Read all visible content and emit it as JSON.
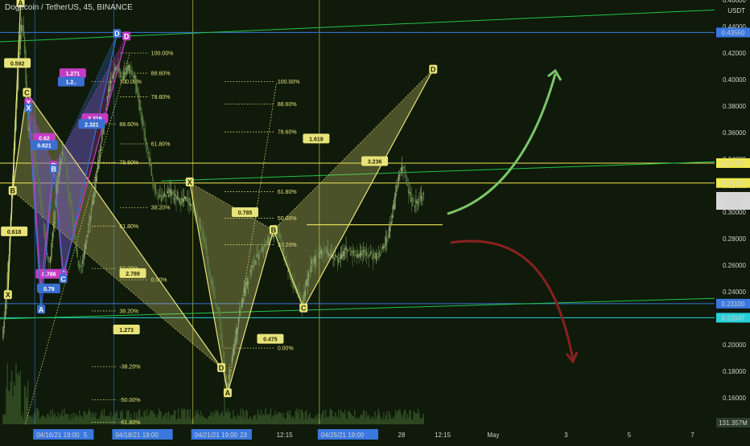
{
  "symbol_title": "Dogecoin / TetherUS, 45, BINANCE",
  "currency_label": "USDT",
  "colors": {
    "background": "#0f1a0a",
    "candle_up": "#8aa36b",
    "candle_down": "#5c7a40",
    "volume": "#2f4a22",
    "pattern_yellow": "#e8e37a",
    "pattern_magenta": "#c43cc4",
    "pattern_blue": "#3a6ed0",
    "line_green": "#22c34a",
    "line_blue": "#3a78e0",
    "line_cyan": "#26d0d8",
    "line_yellow": "#f0e850",
    "arrow_green": "#7cc46a",
    "arrow_red": "#8a2020",
    "current_price_bg": "#d8d8d8"
  },
  "chart_data": {
    "type": "candlestick",
    "title": "Dogecoin / TetherUS, 45, BINANCE",
    "ylabel": "USDT",
    "scale": "linear",
    "ylim": [
      0.14,
      0.46
    ],
    "price_ticks": [
      "0.46000",
      "0.44000",
      "0.42000",
      "0.40000",
      "0.38000",
      "0.36000",
      "0.34000",
      "0.32000",
      "0.30000",
      "0.28000",
      "0.26000",
      "0.24000",
      "0.22000",
      "0.20000",
      "0.18000",
      "0.16000"
    ],
    "time_ticks": [
      {
        "label": "04/16/21   19:00",
        "t": 0.0,
        "highlight": true
      },
      {
        "label": "5",
        "t": 1.6,
        "highlight": false
      },
      {
        "label": "04/18/21   19:00",
        "t": 2.5,
        "highlight": true
      },
      {
        "label": "04/21/21   19:00",
        "t": 5.0,
        "highlight": true
      },
      {
        "label": "23",
        "t": 6.6,
        "highlight": false
      },
      {
        "label": "12:15",
        "t": 7.9,
        "highlight": false
      },
      {
        "label": "04/25/21   19:00",
        "t": 9.0,
        "highlight": true
      },
      {
        "label": "28",
        "t": 11.6,
        "highlight": false
      },
      {
        "label": "12:15",
        "t": 12.9,
        "highlight": false
      },
      {
        "label": "May",
        "t": 14.5,
        "highlight": false
      },
      {
        "label": "3",
        "t": 16.8,
        "highlight": false
      },
      {
        "label": "5",
        "t": 18.8,
        "highlight": false
      },
      {
        "label": "7",
        "t": 20.8,
        "highlight": false
      }
    ],
    "tlim": [
      -1.1,
      21.5
    ],
    "price_path": [
      [
        -1.0,
        0.205
      ],
      [
        -0.9,
        0.228
      ],
      [
        -0.8,
        0.262
      ],
      [
        -0.7,
        0.31
      ],
      [
        -0.55,
        0.385
      ],
      [
        -0.4,
        0.445
      ],
      [
        -0.3,
        0.432
      ],
      [
        -0.2,
        0.365
      ],
      [
        -0.1,
        0.36
      ],
      [
        0.0,
        0.34
      ],
      [
        0.1,
        0.33
      ],
      [
        0.25,
        0.302
      ],
      [
        0.4,
        0.27
      ],
      [
        0.5,
        0.262
      ],
      [
        0.6,
        0.285
      ],
      [
        0.75,
        0.325
      ],
      [
        0.9,
        0.345
      ],
      [
        1.0,
        0.338
      ],
      [
        1.1,
        0.315
      ],
      [
        1.25,
        0.29
      ],
      [
        1.4,
        0.262
      ],
      [
        1.5,
        0.258
      ],
      [
        1.6,
        0.272
      ],
      [
        1.8,
        0.3
      ],
      [
        2.0,
        0.33
      ],
      [
        2.2,
        0.365
      ],
      [
        2.4,
        0.395
      ],
      [
        2.6,
        0.412
      ],
      [
        2.8,
        0.398
      ],
      [
        2.9,
        0.405
      ],
      [
        3.0,
        0.41
      ],
      [
        3.2,
        0.4
      ],
      [
        3.4,
        0.372
      ],
      [
        3.6,
        0.345
      ],
      [
        3.8,
        0.32
      ],
      [
        4.0,
        0.31
      ],
      [
        4.3,
        0.315
      ],
      [
        4.6,
        0.308
      ],
      [
        4.8,
        0.31
      ],
      [
        5.0,
        0.305
      ],
      [
        5.2,
        0.292
      ],
      [
        5.4,
        0.278
      ],
      [
        5.5,
        0.262
      ],
      [
        5.6,
        0.248
      ],
      [
        5.75,
        0.232
      ],
      [
        5.85,
        0.225
      ],
      [
        5.95,
        0.2
      ],
      [
        6.0,
        0.19
      ],
      [
        6.05,
        0.175
      ],
      [
        6.1,
        0.168
      ],
      [
        6.2,
        0.18
      ],
      [
        6.35,
        0.2
      ],
      [
        6.5,
        0.225
      ],
      [
        6.7,
        0.245
      ],
      [
        6.9,
        0.258
      ],
      [
        7.1,
        0.268
      ],
      [
        7.3,
        0.275
      ],
      [
        7.5,
        0.282
      ],
      [
        7.7,
        0.285
      ],
      [
        7.85,
        0.276
      ],
      [
        8.0,
        0.26
      ],
      [
        8.2,
        0.246
      ],
      [
        8.4,
        0.235
      ],
      [
        8.5,
        0.23
      ],
      [
        8.6,
        0.245
      ],
      [
        8.8,
        0.262
      ],
      [
        9.0,
        0.268
      ],
      [
        9.3,
        0.27
      ],
      [
        9.6,
        0.264
      ],
      [
        9.9,
        0.272
      ],
      [
        10.2,
        0.268
      ],
      [
        10.5,
        0.27
      ],
      [
        10.8,
        0.266
      ],
      [
        11.0,
        0.27
      ],
      [
        11.2,
        0.282
      ],
      [
        11.35,
        0.3
      ],
      [
        11.45,
        0.315
      ],
      [
        11.55,
        0.328
      ],
      [
        11.65,
        0.335
      ],
      [
        11.75,
        0.328
      ],
      [
        11.9,
        0.312
      ],
      [
        12.0,
        0.305
      ],
      [
        12.15,
        0.31
      ],
      [
        12.3,
        0.312
      ]
    ],
    "current_price": 0.31154,
    "countdown": "20:30",
    "volume_label": "131.357M",
    "horizontal_levels": [
      {
        "value": 0.4355,
        "label": "0.43550",
        "color": "#3a78e0"
      },
      {
        "value": 0.337,
        "label": "0.33700",
        "color": "#f0e850"
      },
      {
        "value": 0.322,
        "label": "0.32200",
        "color": "#f0e850"
      },
      {
        "value": 0.231,
        "label": "0.23100",
        "color": "#3a78e0"
      },
      {
        "value": 0.22037,
        "label": "0.22037",
        "color": "#26d0d8"
      }
    ],
    "trendlines": [
      {
        "t1": -1.1,
        "p1": 0.4285,
        "t2": 21.5,
        "p2": 0.4525,
        "color": "#22c34a"
      },
      {
        "t1": 4.0,
        "p1": 0.3235,
        "t2": 21.5,
        "p2": 0.338,
        "color": "#22c34a"
      },
      {
        "t1": -1.1,
        "p1": 0.2195,
        "t2": 21.5,
        "p2": 0.235,
        "color": "#22c34a"
      }
    ],
    "vertical_markers": [
      {
        "t": 0.0,
        "color": "#3a78e0"
      },
      {
        "t": 2.5,
        "color": "#3a78e0"
      },
      {
        "t": 5.0,
        "color": "#f0e850"
      },
      {
        "t": 9.0,
        "color": "#f0e850"
      }
    ],
    "yellow_segment": {
      "t1": 8.6,
      "t2": 12.9,
      "value": 0.2905
    },
    "patterns": [
      {
        "name": "yellow-main",
        "color": "#e8e37a",
        "points": [
          {
            "label": "X",
            "t": 4.9,
            "p": 0.3225
          },
          {
            "label": "A",
            "t": 6.1,
            "p": 0.1635
          },
          {
            "label": "B",
            "t": 7.55,
            "p": 0.2865
          },
          {
            "label": "C",
            "t": 8.5,
            "p": 0.2275
          },
          {
            "label": "D",
            "t": 12.6,
            "p": 0.4075
          }
        ],
        "ratios": [
          {
            "text": "0.785",
            "t": 6.65,
            "p": 0.3
          },
          {
            "text": "0.475",
            "t": 7.45,
            "p": 0.2045
          },
          {
            "text": "1.619",
            "t": 8.9,
            "p": 0.3555
          },
          {
            "text": "3.236",
            "t": 10.75,
            "p": 0.3385
          }
        ]
      },
      {
        "name": "yellow-left",
        "color": "#e8e37a",
        "points": [
          {
            "label": "X",
            "t": -0.85,
            "p": 0.2375
          },
          {
            "label": "A",
            "t": -0.45,
            "p": 0.4575
          },
          {
            "label": "B",
            "t": -0.7,
            "p": 0.316
          },
          {
            "label": "C",
            "t": -0.25,
            "p": 0.39
          },
          {
            "label": "D",
            "t": 5.9,
            "p": 0.1825
          }
        ],
        "ratios": [
          {
            "text": "0.592",
            "t": -0.55,
            "p": 0.4125
          },
          {
            "text": "0.618",
            "t": -0.65,
            "p": 0.2855
          },
          {
            "text": "2.789",
            "t": 3.1,
            "p": 0.254
          },
          {
            "text": "1.273",
            "t": 2.9,
            "p": 0.2115
          }
        ]
      },
      {
        "name": "magenta",
        "color": "#c43cc4",
        "points": [
          {
            "label": "X",
            "t": -0.2,
            "p": 0.3825
          },
          {
            "label": "A",
            "t": 0.2,
            "p": 0.2425
          },
          {
            "label": "B",
            "t": 0.6,
            "p": 0.335
          },
          {
            "label": "C",
            "t": 0.9,
            "p": 0.2535
          },
          {
            "label": "D",
            "t": 2.9,
            "p": 0.4325
          }
        ],
        "ratios": [
          {
            "text": "0.62",
            "t": 0.3,
            "p": 0.356
          },
          {
            "text": "0.786",
            "t": 0.45,
            "p": 0.2535
          },
          {
            "text": "1.271",
            "t": 1.2,
            "p": 0.4048
          },
          {
            "text": "2.336",
            "t": 1.9,
            "p": 0.3708
          }
        ]
      },
      {
        "name": "blue",
        "color": "#3a6ed0",
        "points": [
          {
            "label": "X",
            "t": -0.2,
            "p": 0.3785
          },
          {
            "label": "A",
            "t": 0.2,
            "p": 0.2265
          },
          {
            "label": "B",
            "t": 0.6,
            "p": 0.3325
          },
          {
            "label": "C",
            "t": 0.9,
            "p": 0.2495
          },
          {
            "label": "D",
            "t": 2.6,
            "p": 0.4345
          }
        ],
        "ratios": [
          {
            "text": "0.621",
            "t": 0.3,
            "p": 0.3505
          },
          {
            "text": "0.79",
            "t": 0.45,
            "p": 0.2425
          },
          {
            "text": "1.2..",
            "t": 1.15,
            "p": 0.3985
          },
          {
            "text": "2.321",
            "t": 1.8,
            "p": 0.3665
          }
        ]
      }
    ],
    "fib_groups": [
      {
        "t1": 2.7,
        "t2": 3.6,
        "levels": [
          {
            "text": "100.00%",
            "p": 0.42
          },
          {
            "text": "88.60%",
            "p": 0.4048
          },
          {
            "text": "78.60%",
            "p": 0.387
          },
          {
            "text": "61.80%",
            "p": 0.3515
          },
          {
            "text": "38.20%",
            "p": 0.3035
          },
          {
            "text": "0.00%",
            "p": 0.249
          }
        ]
      },
      {
        "t1": 1.8,
        "t2": 2.6,
        "levels": [
          {
            "text": "100.00%",
            "p": 0.3985
          },
          {
            "text": "88.60%",
            "p": 0.3665
          },
          {
            "text": "78.60%",
            "p": 0.3375
          },
          {
            "text": "61.80%",
            "p": 0.2895
          },
          {
            "text": "50.00%",
            "p": 0.2575
          },
          {
            "text": "38.20%",
            "p": 0.2255
          },
          {
            "text": "-38.20%",
            "p": 0.1835
          },
          {
            "text": "-50.00%",
            "p": 0.1585
          },
          {
            "text": "-61.80%",
            "p": 0.1415
          }
        ]
      },
      {
        "t1": 6.0,
        "t2": 7.6,
        "levels": [
          {
            "text": "100.00%",
            "p": 0.3985
          },
          {
            "text": "88.60%",
            "p": 0.3815
          },
          {
            "text": "78.60%",
            "p": 0.3605
          },
          {
            "text": "61.80%",
            "p": 0.3155
          },
          {
            "text": "50.00%",
            "p": 0.2955
          },
          {
            "text": "38.20%",
            "p": 0.2755
          },
          {
            "text": "0.00%",
            "p": 0.1975
          }
        ]
      }
    ],
    "fib_rays": [
      {
        "t1": 6.1,
        "p1": 0.1635,
        "t2": 7.65,
        "p2": 0.3985
      },
      {
        "t1": -0.3,
        "p1": 0.14,
        "t2": 3.0,
        "p2": 0.42
      }
    ],
    "projection_arrows": [
      {
        "direction": "up",
        "color": "#7cc46a"
      },
      {
        "direction": "down",
        "color": "#8a2020"
      }
    ]
  }
}
